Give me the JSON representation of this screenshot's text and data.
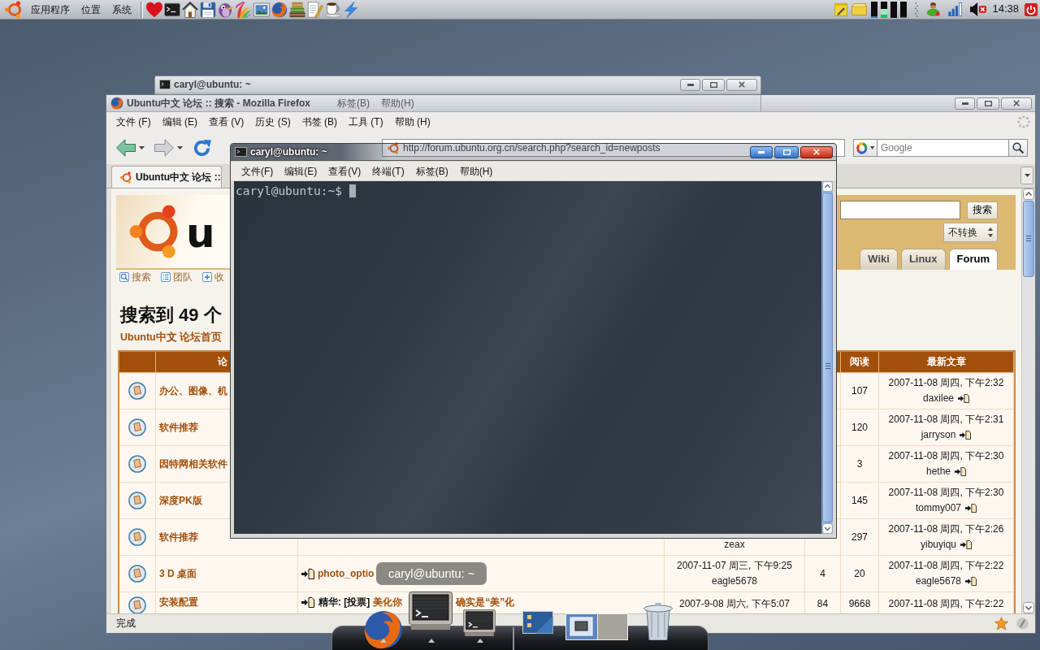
{
  "top_panel": {
    "menus": [
      "应用程序",
      "位置",
      "系统"
    ],
    "volume": {
      "muted": true
    },
    "clock": "14:38"
  },
  "background_window": {
    "title": "caryl@ubuntu: ~",
    "active": false,
    "menu": [
      "标签(B)",
      "帮助(H)"
    ]
  },
  "browser": {
    "title": "Ubuntu中文 论坛 :: 搜索 - Mozilla Firefox",
    "active": false,
    "menu": [
      "文件 (F)",
      "编辑 (E)",
      "查看 (V)",
      "历史 (S)",
      "书签 (B)",
      "工具 (T)",
      "帮助 (H)"
    ],
    "address": "http://forum.ubuntu.org.cn/search.php?search_id=newposts",
    "search": {
      "placeholder": "Google"
    },
    "tabs": [
      {
        "label": "Ubuntu中文 论坛 ::",
        "selected": true
      }
    ],
    "page": {
      "logo_text": "u",
      "site_search_button": "搜索",
      "converter": "不转换",
      "site_tabs": [
        {
          "label": "Wiki",
          "selected": false
        },
        {
          "label": "Linux",
          "selected": false
        },
        {
          "label": "Forum",
          "selected": true
        }
      ],
      "links": [
        "搜索",
        "团队",
        "收"
      ],
      "heading": "搜索到 49 个",
      "breadcrumb": "Ubuntu中文 论坛首页",
      "table": {
        "columns": {
          "forum": "论",
          "reads": "阅读",
          "latest_post": "最新文章"
        },
        "rows": [
          {
            "forum": "办公、图像、机",
            "reads": "107",
            "latest_post": {
              "date": "2007-11-08 周四, 下午2:32",
              "user": "daxilee"
            }
          },
          {
            "forum": "软件推荐",
            "reads": "120",
            "latest_post": {
              "date": "2007-11-08 周四, 下午2:31",
              "user": "jarryson"
            }
          },
          {
            "forum": "因特网相关软件",
            "reads": "3",
            "latest_post": {
              "date": "2007-11-08 周四, 下午2:30",
              "user": "hethe"
            }
          },
          {
            "forum": "深度PK版",
            "reads": "145",
            "latest_post": {
              "date": "2007-11-08 周四, 下午2:30",
              "user": "tommy007"
            }
          },
          {
            "forum": "软件推荐",
            "column_4": {
              "user": "zeax"
            },
            "reads": "297",
            "latest_post": {
              "date": "2007-11-08 周四, 下午2:26",
              "user": "yibuyiqu"
            }
          },
          {
            "forum": "3 D 桌面",
            "topic": {
              "title_parts": [
                "photo_optio"
              ]
            },
            "column_4": {
              "date": "2007-11-07 周三, 下午9:25",
              "user": "eagle5678"
            },
            "column_5": "4",
            "reads": "20",
            "latest_post": {
              "date": "2007-11-08 周四, 下午2:22",
              "user": "eagle5678"
            }
          },
          {
            "forum": "安装配置",
            "topic": {
              "prefix": "精华: [投票]",
              "title_parts": [
                "美化你",
                "确实是“美”化"
              ]
            },
            "column_4": {
              "date": "2007-9-08 周六, 下午5:07"
            },
            "column_5": "84",
            "reads": "9668",
            "latest_post": {
              "date": "2007-11-08 周四, 下午2:22"
            }
          }
        ]
      }
    },
    "status": "完成"
  },
  "terminal": {
    "title": "caryl@ubuntu: ~",
    "active": true,
    "menu": [
      "文件(F)",
      "编辑(E)",
      "查看(V)",
      "终端(T)",
      "标签(B)",
      "帮助(H)"
    ],
    "prompt": "caryl@ubuntu:~$"
  },
  "dock": {
    "tooltip": "caryl@ubuntu: ~",
    "items": [
      {
        "kind": "browser",
        "running": true
      },
      {
        "kind": "terminal",
        "running": true
      },
      {
        "kind": "terminal",
        "running": true
      },
      {
        "kind": "separator"
      },
      {
        "kind": "desktop",
        "running": false
      },
      {
        "kind": "pager",
        "running": false
      },
      {
        "kind": "trash",
        "running": false
      }
    ]
  }
}
